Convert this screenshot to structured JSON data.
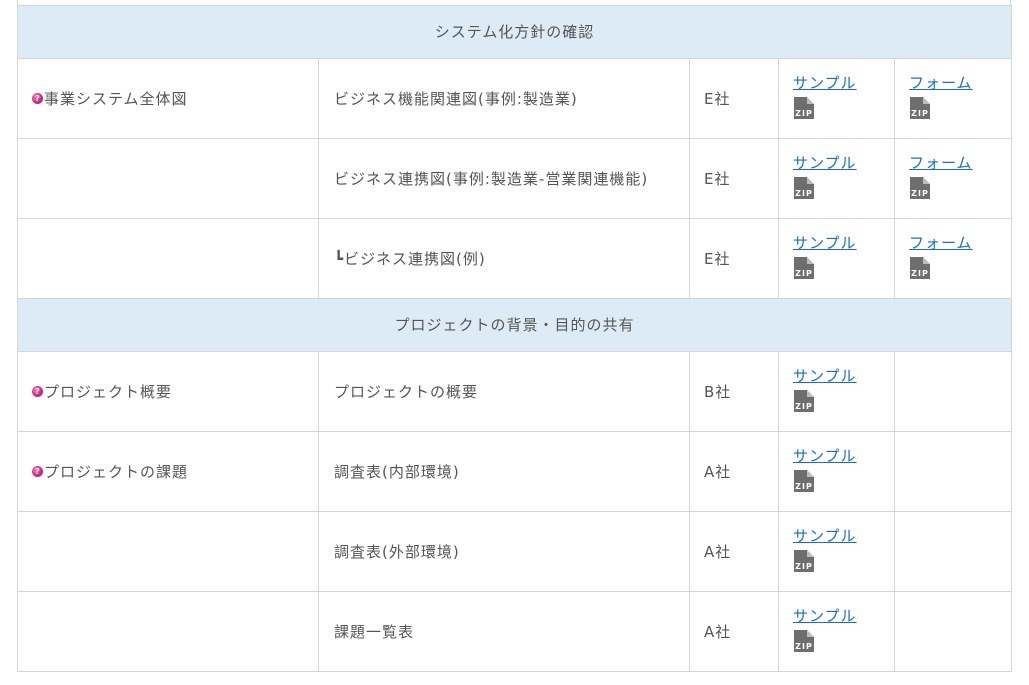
{
  "colors": {
    "section_bg": "#ddebf6",
    "link": "#1a6fc4",
    "border": "#d6d6d6",
    "text": "#555555",
    "question_icon": "#d4237a"
  },
  "icons": {
    "question": "question-circle-icon",
    "zip": "zip-file-icon"
  },
  "sections": [
    {
      "title": "システム化方針の確認",
      "rows": [
        {
          "category": "事業システム全体図",
          "has_icon": true,
          "name": "ビジネス機能関連図(事例:製造業)",
          "company": "E社",
          "sample": "サンプル",
          "form": "フォーム",
          "zip_sample": "ZIP",
          "zip_form": "ZIP"
        },
        {
          "category": "",
          "has_icon": false,
          "name": "ビジネス連携図(事例:製造業-営業関連機能)",
          "company": "E社",
          "sample": "サンプル",
          "form": "フォーム",
          "zip_sample": "ZIP",
          "zip_form": "ZIP"
        },
        {
          "category": "",
          "has_icon": false,
          "name": "┗ビジネス連携図(例)",
          "company": "E社",
          "sample": "サンプル",
          "form": "フォーム",
          "zip_sample": "ZIP",
          "zip_form": "ZIP"
        }
      ]
    },
    {
      "title": "プロジェクトの背景・目的の共有",
      "rows": [
        {
          "category": "プロジェクト概要",
          "has_icon": true,
          "name": "プロジェクトの概要",
          "company": "B社",
          "sample": "サンプル",
          "form": "",
          "zip_sample": "ZIP",
          "zip_form": ""
        },
        {
          "category": "プロジェクトの課題",
          "has_icon": true,
          "name": "調査表(内部環境)",
          "company": "A社",
          "sample": "サンプル",
          "form": "",
          "zip_sample": "ZIP",
          "zip_form": ""
        },
        {
          "category": "",
          "has_icon": false,
          "name": "調査表(外部環境)",
          "company": "A社",
          "sample": "サンプル",
          "form": "",
          "zip_sample": "ZIP",
          "zip_form": ""
        },
        {
          "category": "",
          "has_icon": false,
          "name": "課題一覧表",
          "company": "A社",
          "sample": "サンプル",
          "form": "",
          "zip_sample": "ZIP",
          "zip_form": ""
        }
      ]
    }
  ]
}
